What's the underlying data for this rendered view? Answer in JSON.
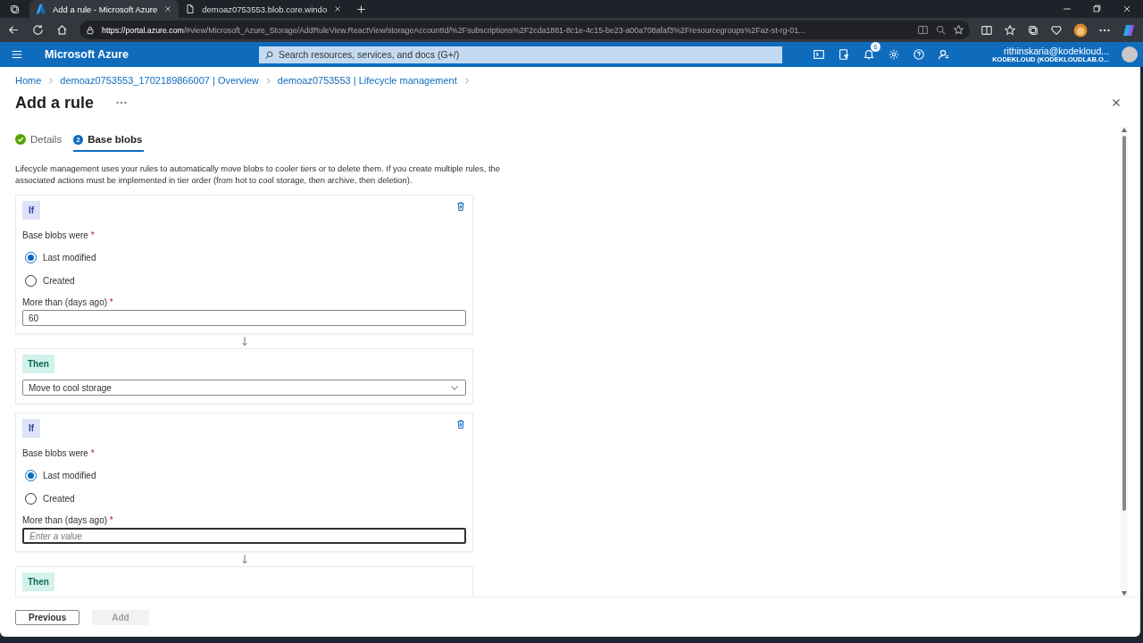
{
  "browser": {
    "tabs": [
      {
        "title": "Add a rule - Microsoft Azure",
        "kind": "azure",
        "selected": true
      },
      {
        "title": "demoaz0753553.blob.core.windo",
        "kind": "page",
        "selected": false
      }
    ],
    "url_host": "https://portal.azure.com",
    "url_path": "/#view/Microsoft_Azure_Storage/AddRuleView.ReactView/storageAccountId/%2Fsubscriptions%2F2cda1881-8c1e-4c15-be23-a00a708afaf3%2Fresourcegroups%2Faz-st-rg-01..."
  },
  "header": {
    "brand": "Microsoft Azure",
    "search_placeholder": "Search resources, services, and docs (G+/)",
    "notification_count": "6",
    "user": "rithinskaria@kodekloud...",
    "tenant": "KODEKLOUD (KODEKLOUDLAB.O..."
  },
  "breadcrumb": [
    "Home",
    "demoaz0753553_1702189866007 | Overview",
    "demoaz0753553 | Lifecycle management"
  ],
  "title": "Add a rule",
  "steps": [
    {
      "label": "Details",
      "kind": "done",
      "selected": false
    },
    {
      "label": "Base blobs",
      "number": "2",
      "kind": "current",
      "selected": true
    }
  ],
  "description": "Lifecycle management uses your rules to automatically move blobs to cooler tiers or to delete them. If you create multiple rules, the associated actions must be implemented in tier order (from hot to cool storage, then archive, then deletion).",
  "blocks": [
    {
      "kind": "if",
      "badge": "If",
      "label": "Base blobs were",
      "required_mark": "*",
      "options": [
        {
          "label": "Last modified",
          "selected": true
        },
        {
          "label": "Created",
          "selected": false
        }
      ],
      "days_label": "More than (days ago)",
      "days_required_mark": "*",
      "days_value": "60",
      "focused": false
    },
    {
      "kind": "then",
      "badge": "Then",
      "action": "Move to cool storage"
    },
    {
      "kind": "if",
      "badge": "If",
      "label": "Base blobs were",
      "required_mark": "*",
      "options": [
        {
          "label": "Last modified",
          "selected": true
        },
        {
          "label": "Created",
          "selected": false
        }
      ],
      "days_label": "More than (days ago)",
      "days_required_mark": "*",
      "days_placeholder": "Enter a value",
      "focused": true
    },
    {
      "kind": "then",
      "badge": "Then"
    }
  ],
  "buttons": [
    {
      "label": "Previous",
      "disabled": false
    },
    {
      "label": "Add",
      "disabled": true
    }
  ]
}
